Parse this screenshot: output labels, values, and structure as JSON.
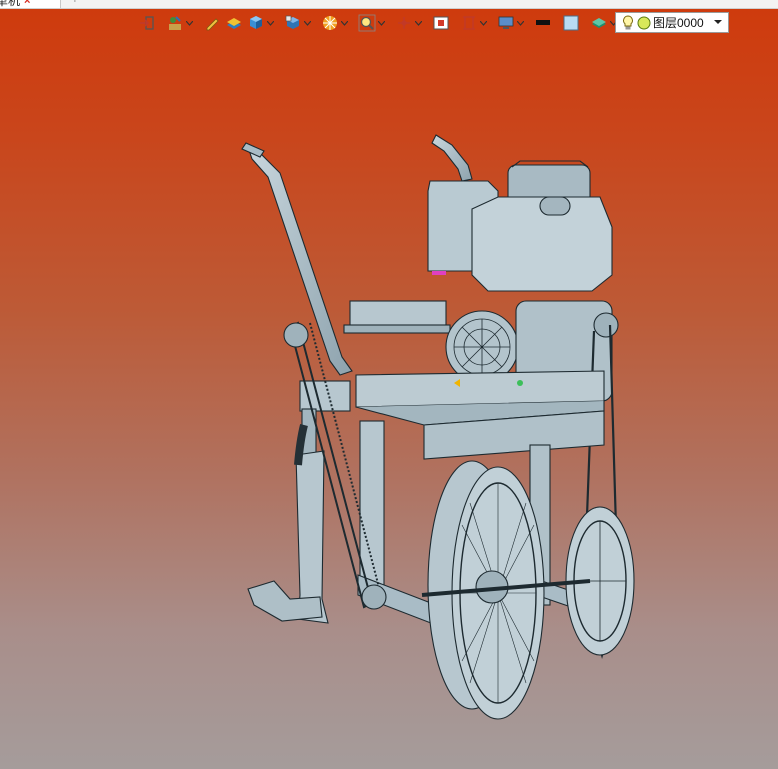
{
  "document_tab": {
    "label": "犁机",
    "close_glyph": "×",
    "add_glyph": "+"
  },
  "toolbar": {
    "items": [
      {
        "icon": "import-icon"
      },
      {
        "icon": "attribute-icon",
        "has_menu": true
      },
      {
        "icon": "pen-icon"
      },
      {
        "icon": "stack-icon"
      },
      {
        "icon": "cube-icon",
        "has_menu": true
      },
      {
        "icon": "view-cube-icon",
        "has_menu": true
      },
      {
        "icon": "render-icon",
        "has_menu": true
      },
      {
        "icon": "zoom-icon",
        "has_menu": true
      },
      {
        "icon": "snap-icon",
        "has_menu": true
      },
      {
        "icon": "fit-icon"
      },
      {
        "icon": "section-icon",
        "has_menu": true
      },
      {
        "icon": "display-icon",
        "has_menu": true
      },
      {
        "icon": "line-color-icon"
      },
      {
        "icon": "fill-color-icon"
      },
      {
        "icon": "layer-tool-icon",
        "has_menu": true
      }
    ],
    "colors": {
      "line": "#111111",
      "fill": "#b9dcf3"
    }
  },
  "layer": {
    "label": "图层0000",
    "bulb_icon": "lightbulb-icon",
    "state_icon": "layer-state-icon"
  },
  "viewport": {
    "model_icon": "rotary-tiller-model",
    "gradient_top": "#cf3a0c",
    "gradient_bottom": "#a59c9b",
    "model_color": "#a9bcc6"
  }
}
